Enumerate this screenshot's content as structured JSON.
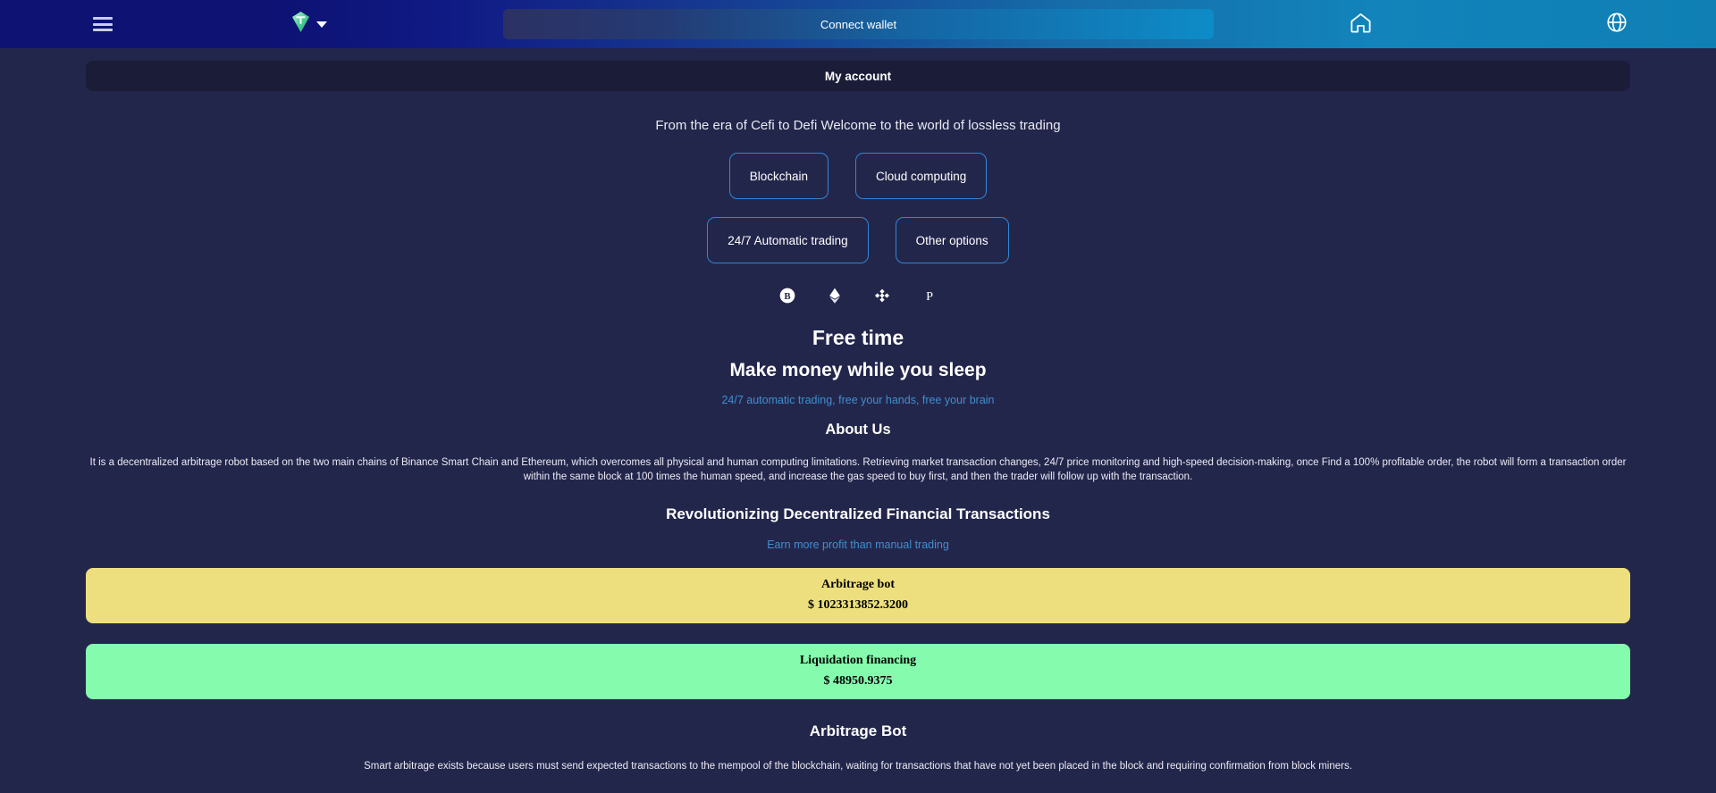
{
  "header": {
    "menu_icon": "hamburger-menu-icon",
    "logo_icon": "tether-gem-logo-icon",
    "logo_dropdown_icon": "chevron-down-icon",
    "connect_wallet_label": "Connect wallet",
    "home_icon": "home-icon",
    "language_icon": "globe-icon",
    "gradient_start": "#0d1273",
    "gradient_end": "#0f7fb4"
  },
  "account": {
    "label": "My account"
  },
  "hero": {
    "tagline": "From the era of Cefi to Defi Welcome to the world of lossless trading",
    "pills_row1": [
      {
        "label": "Blockchain"
      },
      {
        "label": "Cloud computing"
      }
    ],
    "pills_row2": [
      {
        "label": "24/7 Automatic trading"
      },
      {
        "label": "Other options"
      }
    ],
    "coins": [
      {
        "name": "bitcoin-icon"
      },
      {
        "name": "ethereum-icon"
      },
      {
        "name": "binance-icon"
      },
      {
        "name": "polkadot-icon"
      }
    ],
    "heading_small": "Free time",
    "heading_large": "Make money while you sleep",
    "subtitle": "24/7 automatic trading, free your hands, free your brain",
    "accent_color": "#3f8fd0"
  },
  "about": {
    "heading": "About Us",
    "body": "It is a decentralized arbitrage robot based on the two main chains of Binance Smart Chain and Ethereum, which overcomes all physical and human computing limitations. Retrieving market transaction changes, 24/7 price monitoring and high-speed decision-making, once Find a 100% profitable order, the robot will form a transaction order within the same block at 100 times the human speed, and increase the gas speed to buy first, and then the trader will follow up with the transaction."
  },
  "revolution": {
    "heading": "Revolutionizing Decentralized Financial Transactions",
    "subtitle": "Earn more profit than manual trading"
  },
  "stats": [
    {
      "title": "Arbitrage bot",
      "value": "$ 1023313852.3200",
      "color": "#eddf7e"
    },
    {
      "title": "Liquidation financing",
      "value": "$ 48950.9375",
      "color": "#85fbae"
    }
  ],
  "arbitrage_bot": {
    "heading": "Arbitrage Bot",
    "body": "Smart arbitrage exists because users must send expected transactions to the mempool of the blockchain, waiting for transactions that have not yet been placed in the block and requiring confirmation from block miners."
  }
}
